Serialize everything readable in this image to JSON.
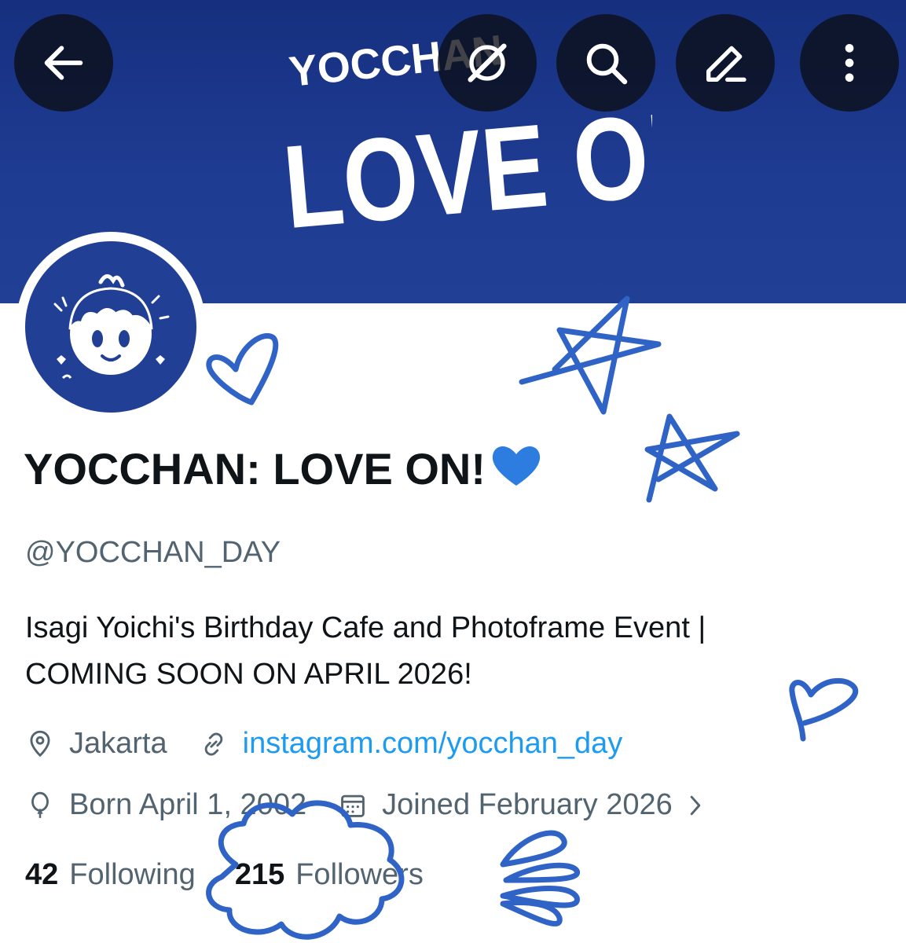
{
  "banner": {
    "logo_small": "YOCCHAN",
    "logo_large": "LOVE ON!",
    "bg_color": "#213f95"
  },
  "header_actions": {
    "back_icon": "arrow-left-icon",
    "grok_icon": "grok-icon",
    "search_icon": "search-icon",
    "edit_icon": "edit-icon",
    "more_icon": "more-vertical-icon"
  },
  "profile": {
    "display_name": "YOCCHAN: LOVE ON!",
    "name_emoji_icon": "blue-heart-icon",
    "handle": "@YOCCHAN_DAY",
    "bio_lines": [
      "Isagi Yoichi's Birthday Cafe and Photoframe Event |",
      "COMING SOON ON APRIL 2026!"
    ],
    "location": "Jakarta",
    "website": "instagram.com/yocchan_day",
    "birthday": "Born April 1, 2002",
    "joined": "Joined February 2026",
    "following_count": "42",
    "following_label": "Following",
    "followers_count": "215",
    "followers_label": "Followers"
  },
  "colors": {
    "text": "#0f1419",
    "muted": "#536471",
    "link": "#1d9bf0",
    "doodle": "#2f63c6"
  }
}
